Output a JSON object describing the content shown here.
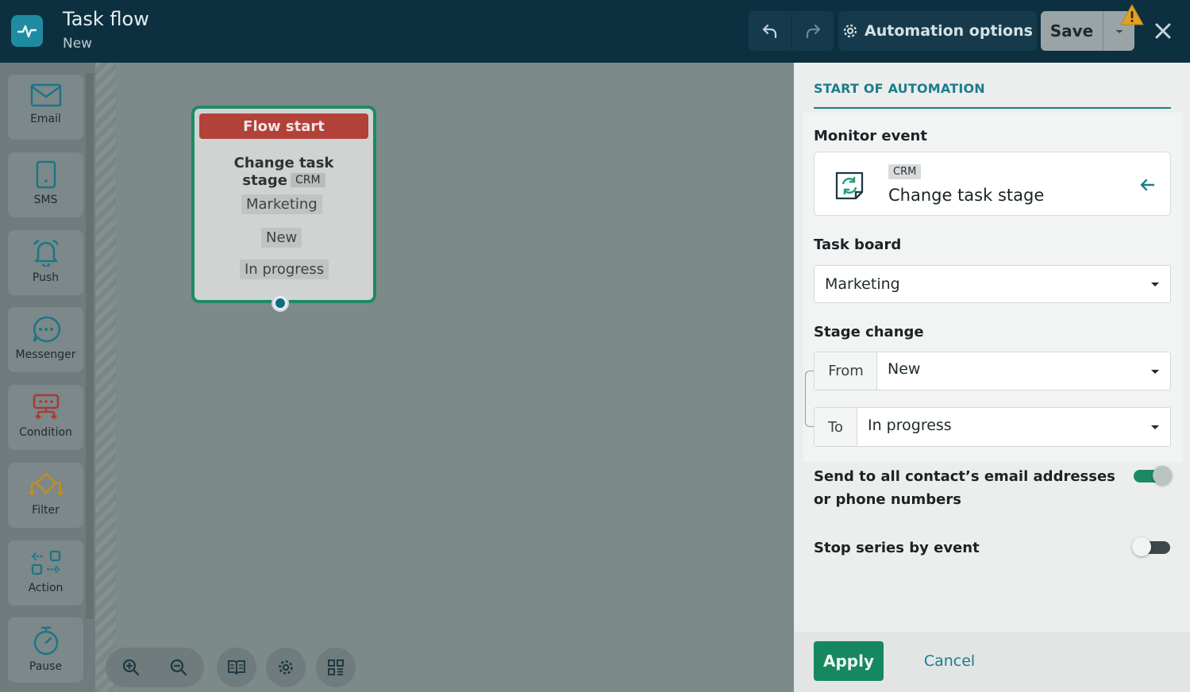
{
  "header": {
    "title": "Task flow",
    "subtitle": "New",
    "automation_options": "Automation options",
    "save": "Save",
    "icons": [
      "undo-icon",
      "redo-icon",
      "gear-icon",
      "chevron-down-icon",
      "warning-icon",
      "close-icon"
    ]
  },
  "toolbar": {
    "items": [
      {
        "label": "Email",
        "icon": "envelope-icon"
      },
      {
        "label": "SMS",
        "icon": "phone-icon"
      },
      {
        "label": "Push",
        "icon": "bell-icon"
      },
      {
        "label": "Messenger",
        "icon": "chat-icon"
      },
      {
        "label": "Condition",
        "icon": "condition-icon"
      },
      {
        "label": "Filter",
        "icon": "filter-icon"
      },
      {
        "label": "Action",
        "icon": "action-icon"
      },
      {
        "label": "Pause",
        "icon": "stopwatch-icon"
      }
    ]
  },
  "node": {
    "header": "Flow start",
    "title_line1": "Change task",
    "title_line2": "stage",
    "tag": "CRM",
    "board": "Marketing",
    "from": "New",
    "to": "In progress"
  },
  "panel": {
    "tab": "START OF AUTOMATION",
    "monitor_label": "Monitor event",
    "event_tag": "CRM",
    "event_name": "Change task stage",
    "board_label": "Task board",
    "board_value": "Marketing",
    "stage_label": "Stage change",
    "from_label": "From",
    "from_value": "New",
    "to_label": "To",
    "to_value": "In progress",
    "send_all_label": "Send to all contact’s email addresses or phone numbers",
    "send_all_on": true,
    "stop_series_label": "Stop series by event",
    "stop_series_on": false,
    "apply": "Apply",
    "cancel": "Cancel"
  },
  "colors": {
    "header_bg": "#0d3040",
    "accent": "#1d7d8c",
    "apply": "#17875f",
    "flow_start": "#b2413a",
    "node_border": "#1f8a63"
  }
}
